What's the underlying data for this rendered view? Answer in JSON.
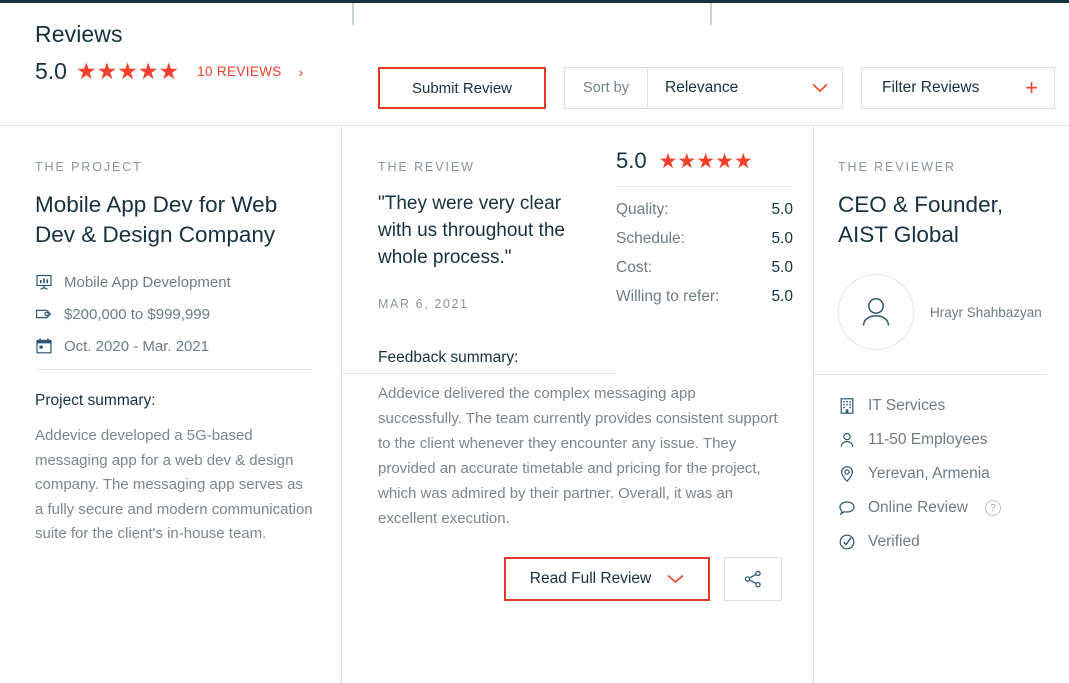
{
  "header": {
    "title": "Reviews",
    "rating": "5.0",
    "stars": 5,
    "reviews_count_label": "10 REVIEWS",
    "chevron_right_icon": "chevron-right-icon",
    "submit_button": "Submit Review",
    "sort_by_label": "Sort by",
    "sort_value": "Relevance",
    "sort_options": [
      "Relevance"
    ],
    "filter_label": "Filter Reviews",
    "filter_icon": "plus-icon"
  },
  "project": {
    "eyebrow": "THE PROJECT",
    "title": "Mobile App Dev for Web Dev & Design Company",
    "meta": [
      {
        "icon": "presentation-chart-icon",
        "label": "Mobile App Development"
      },
      {
        "icon": "price-tag-icon",
        "label": "$200,000 to $999,999"
      },
      {
        "icon": "calendar-icon",
        "label": "Oct. 2020 - Mar. 2021"
      }
    ],
    "summary_heading": "Project summary:",
    "summary_text": "Addevice developed a 5G-based messaging app for a web dev & design company. The messaging app serves as a fully secure and modern communication suite for the client's in-house team."
  },
  "review": {
    "eyebrow": "THE REVIEW",
    "quote": "\"They were very clear with us throughout the whole process.\"",
    "date": "MAR 6, 2021",
    "overall_rating": "5.0",
    "overall_stars": 5,
    "scores": [
      {
        "label": "Quality:",
        "value": "5.0"
      },
      {
        "label": "Schedule:",
        "value": "5.0"
      },
      {
        "label": "Cost:",
        "value": "5.0"
      },
      {
        "label": "Willing to refer:",
        "value": "5.0"
      }
    ],
    "feedback_heading": "Feedback summary:",
    "feedback_text": "Addevice delivered the complex messaging app successfully. The team currently provides consistent support to the client whenever they encounter any issue. They provided an accurate timetable and pricing for the project, which was admired by their partner. Overall, it was an excellent execution.",
    "read_full_label": "Read Full Review",
    "read_full_icon": "chevron-down-icon",
    "share_icon": "share-icon"
  },
  "reviewer": {
    "eyebrow": "THE REVIEWER",
    "title": "CEO & Founder, AIST Global",
    "avatar_icon": "person-avatar-icon",
    "name": "Hrayr Shahbazyan",
    "facts": [
      {
        "icon": "building-icon",
        "label": "IT Services"
      },
      {
        "icon": "person-icon",
        "label": "11-50 Employees"
      },
      {
        "icon": "map-pin-icon",
        "label": "Yerevan, Armenia"
      },
      {
        "icon": "speech-bubble-icon",
        "label": "Online Review",
        "help": "?"
      },
      {
        "icon": "check-circle-icon",
        "label": "Verified"
      }
    ]
  },
  "colors": {
    "accent_red": "#f5402c",
    "button_border_red": "#e03a2b",
    "navy": "#17313f",
    "muted": "#7b868d",
    "border": "#dfe6e9"
  }
}
